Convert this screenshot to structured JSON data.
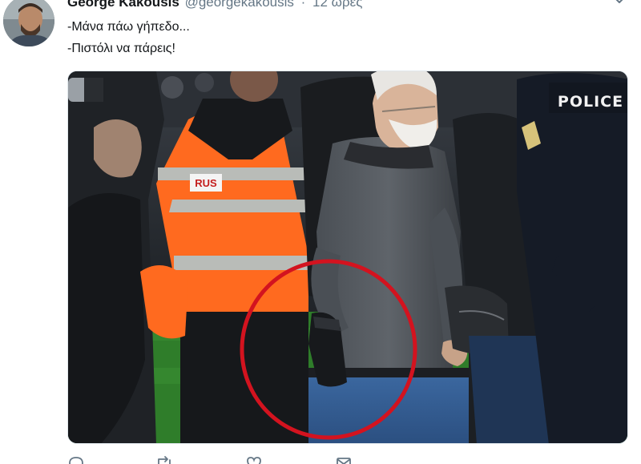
{
  "tweet": {
    "author": {
      "display_name": "George Kakousis",
      "handle": "@georgekakousis",
      "avatar_icon": "user-avatar-icon"
    },
    "separator": "·",
    "timestamp": "12 ώρες",
    "text_lines": [
      "-Μάνα πάω γήπεδο...",
      "-Πιστόλι να πάρεις!"
    ],
    "media": {
      "badge_police": "POLICE",
      "badge_vest": "RUS",
      "highlight_color": "#d3131f"
    },
    "actions": {
      "reply_icon": "reply-icon",
      "retweet_icon": "retweet-icon",
      "like_icon": "heart-icon",
      "dm_icon": "message-icon"
    },
    "colors": {
      "text": "#14171a",
      "secondary": "#657786",
      "vest": "#ff6a1f",
      "reflective": "#b9bcb8",
      "pitch": "#2f7d2a"
    }
  }
}
